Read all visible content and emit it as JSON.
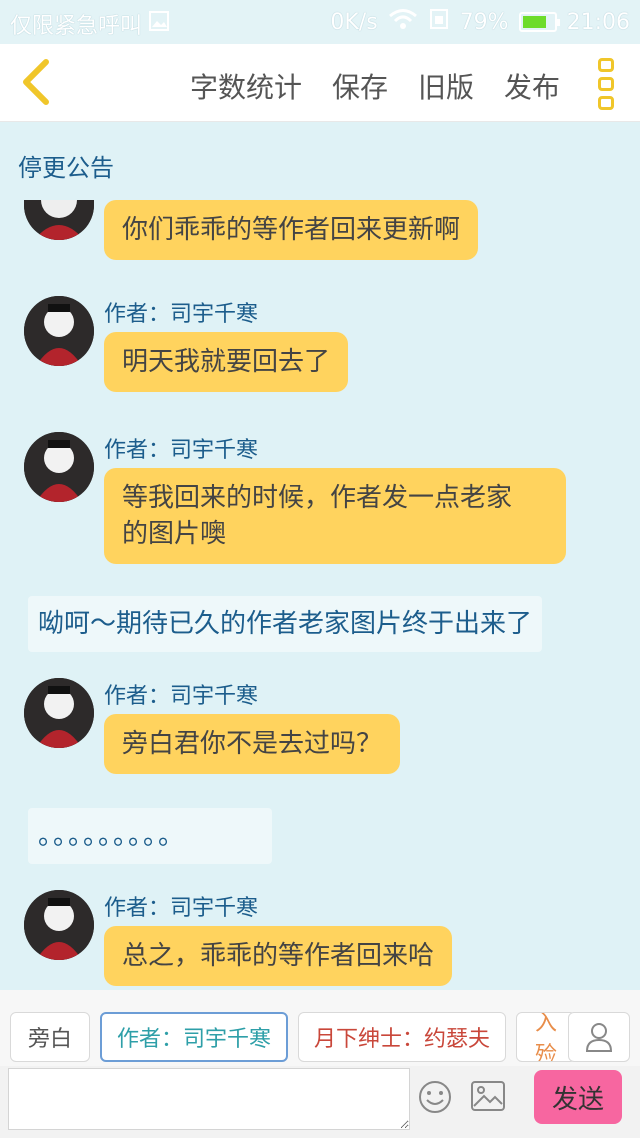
{
  "status_bar": {
    "left_text": "仅限紧急呼叫",
    "speed": "0K/s",
    "battery_percent": "79%",
    "time": "21:06",
    "battery_level": 0.79
  },
  "toolbar": {
    "items": [
      "字数统计",
      "保存",
      "旧版",
      "发布"
    ]
  },
  "notice": "停更公告",
  "messages": [
    {
      "type": "author",
      "name": "",
      "text": "你们乖乖的等作者回来更新啊"
    },
    {
      "type": "author",
      "name": "作者：司宇千寒",
      "text": "明天我就要回去了"
    },
    {
      "type": "author",
      "name": "作者：司宇千寒",
      "text_line1": "等我回来的时候，作者发一点老家",
      "text_line2": "的图片噢"
    },
    {
      "type": "narration",
      "text": "呦呵～期待已久的作者老家图片终于出来了"
    },
    {
      "type": "author",
      "name": "作者：司宇千寒",
      "text": "旁白君你不是去过吗？"
    },
    {
      "type": "narration",
      "text": "。。。。。。。。。"
    },
    {
      "type": "author",
      "name": "作者：司宇千寒",
      "text": "总之，乖乖的等作者回来哈"
    }
  ],
  "roles": {
    "narrator": "旁白",
    "author": "作者：司宇千寒",
    "knight": "月下绅士：约瑟夫",
    "extra": "入殓"
  },
  "input": {
    "value": "",
    "placeholder": ""
  },
  "send_label": "发送",
  "colors": {
    "accent_yellow": "#ffd35e",
    "send_pink": "#f766a0",
    "background": "#dff2f6",
    "name_blue": "#1c5d8c"
  }
}
